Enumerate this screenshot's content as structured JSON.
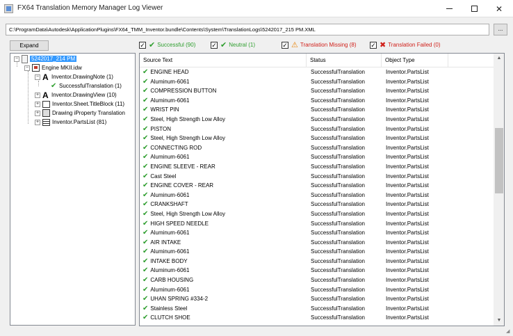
{
  "window": {
    "title": "FX64 Translation Memory Manager Log Viewer",
    "minimize": "—",
    "maximize": "☐",
    "close": "✕"
  },
  "path": {
    "value": "C:\\ProgramData\\Autodesk\\ApplicationPlugins\\FX64_TMM_Inventor.bundle\\Contents\\System\\TranslationLogs\\5242017_215 PM.XML",
    "browse_label": "..."
  },
  "tree": {
    "expand_label": "Expand",
    "root": "5242017_214 PM",
    "document": "Engine MKII.idw",
    "nodes": [
      {
        "label": "Inventor.DrawingNote (1)"
      },
      {
        "label": "SuccessfulTranslation (1)"
      },
      {
        "label": "Inventor.DrawingView (10)"
      },
      {
        "label": "Inventor.Sheet.TitleBlock (11)"
      },
      {
        "label": "Drawing iProperty Translation"
      },
      {
        "label": "Inventor.PartsList (81)"
      }
    ]
  },
  "filters": [
    {
      "label": "Successful (90)",
      "checked": true,
      "icon": "check-icon",
      "color": "#2e9e2e"
    },
    {
      "label": "Neutral (1)",
      "checked": true,
      "icon": "check-icon",
      "color": "#2e9e2e"
    },
    {
      "label": "Translation Missing (8)",
      "checked": true,
      "icon": "warning-icon",
      "color": "#e8850c"
    },
    {
      "label": "Translation Failed (0)",
      "checked": true,
      "icon": "error-x-icon",
      "color": "#d0201a"
    }
  ],
  "grid": {
    "columns": [
      "Source Text",
      "Status",
      "Object Type"
    ],
    "rows": [
      {
        "source": "ENGINE HEAD",
        "status": "SuccessfulTranslation",
        "type": "Inventor.PartsList"
      },
      {
        "source": "Aluminum-6061",
        "status": "SuccessfulTranslation",
        "type": "Inventor.PartsList"
      },
      {
        "source": "COMPRESSION BUTTON",
        "status": "SuccessfulTranslation",
        "type": "Inventor.PartsList"
      },
      {
        "source": "Aluminum-6061",
        "status": "SuccessfulTranslation",
        "type": "Inventor.PartsList"
      },
      {
        "source": "WRIST PIN",
        "status": "SuccessfulTranslation",
        "type": "Inventor.PartsList"
      },
      {
        "source": "Steel, High Strength Low Alloy",
        "status": "SuccessfulTranslation",
        "type": "Inventor.PartsList"
      },
      {
        "source": "PISTON",
        "status": "SuccessfulTranslation",
        "type": "Inventor.PartsList"
      },
      {
        "source": "Steel, High Strength Low Alloy",
        "status": "SuccessfulTranslation",
        "type": "Inventor.PartsList"
      },
      {
        "source": "CONNECTING ROD",
        "status": "SuccessfulTranslation",
        "type": "Inventor.PartsList"
      },
      {
        "source": "Aluminum-6061",
        "status": "SuccessfulTranslation",
        "type": "Inventor.PartsList"
      },
      {
        "source": "ENGINE SLEEVE - REAR",
        "status": "SuccessfulTranslation",
        "type": "Inventor.PartsList"
      },
      {
        "source": "Cast Steel",
        "status": "SuccessfulTranslation",
        "type": "Inventor.PartsList"
      },
      {
        "source": "ENGINE COVER - REAR",
        "status": "SuccessfulTranslation",
        "type": "Inventor.PartsList"
      },
      {
        "source": "Aluminum-6061",
        "status": "SuccessfulTranslation",
        "type": "Inventor.PartsList"
      },
      {
        "source": "CRANKSHAFT",
        "status": "SuccessfulTranslation",
        "type": "Inventor.PartsList"
      },
      {
        "source": "Steel, High Strength Low Alloy",
        "status": "SuccessfulTranslation",
        "type": "Inventor.PartsList"
      },
      {
        "source": "HIGH SPEED NEEDLE",
        "status": "SuccessfulTranslation",
        "type": "Inventor.PartsList"
      },
      {
        "source": "Aluminum-6061",
        "status": "SuccessfulTranslation",
        "type": "Inventor.PartsList"
      },
      {
        "source": "AIR INTAKE",
        "status": "SuccessfulTranslation",
        "type": "Inventor.PartsList"
      },
      {
        "source": "Aluminum-6061",
        "status": "SuccessfulTranslation",
        "type": "Inventor.PartsList"
      },
      {
        "source": "INTAKE BODY",
        "status": "SuccessfulTranslation",
        "type": "Inventor.PartsList"
      },
      {
        "source": "Aluminum-6061",
        "status": "SuccessfulTranslation",
        "type": "Inventor.PartsList"
      },
      {
        "source": "CARB HOUSING",
        "status": "SuccessfulTranslation",
        "type": "Inventor.PartsList"
      },
      {
        "source": "Aluminum-6061",
        "status": "SuccessfulTranslation",
        "type": "Inventor.PartsList"
      },
      {
        "source": "UHAN SPRING #334-2",
        "status": "SuccessfulTranslation",
        "type": "Inventor.PartsList"
      },
      {
        "source": "Stainless Steel",
        "status": "SuccessfulTranslation",
        "type": "Inventor.PartsList"
      },
      {
        "source": "CLUTCH SHOE",
        "status": "SuccessfulTranslation",
        "type": "Inventor.PartsList"
      }
    ]
  }
}
